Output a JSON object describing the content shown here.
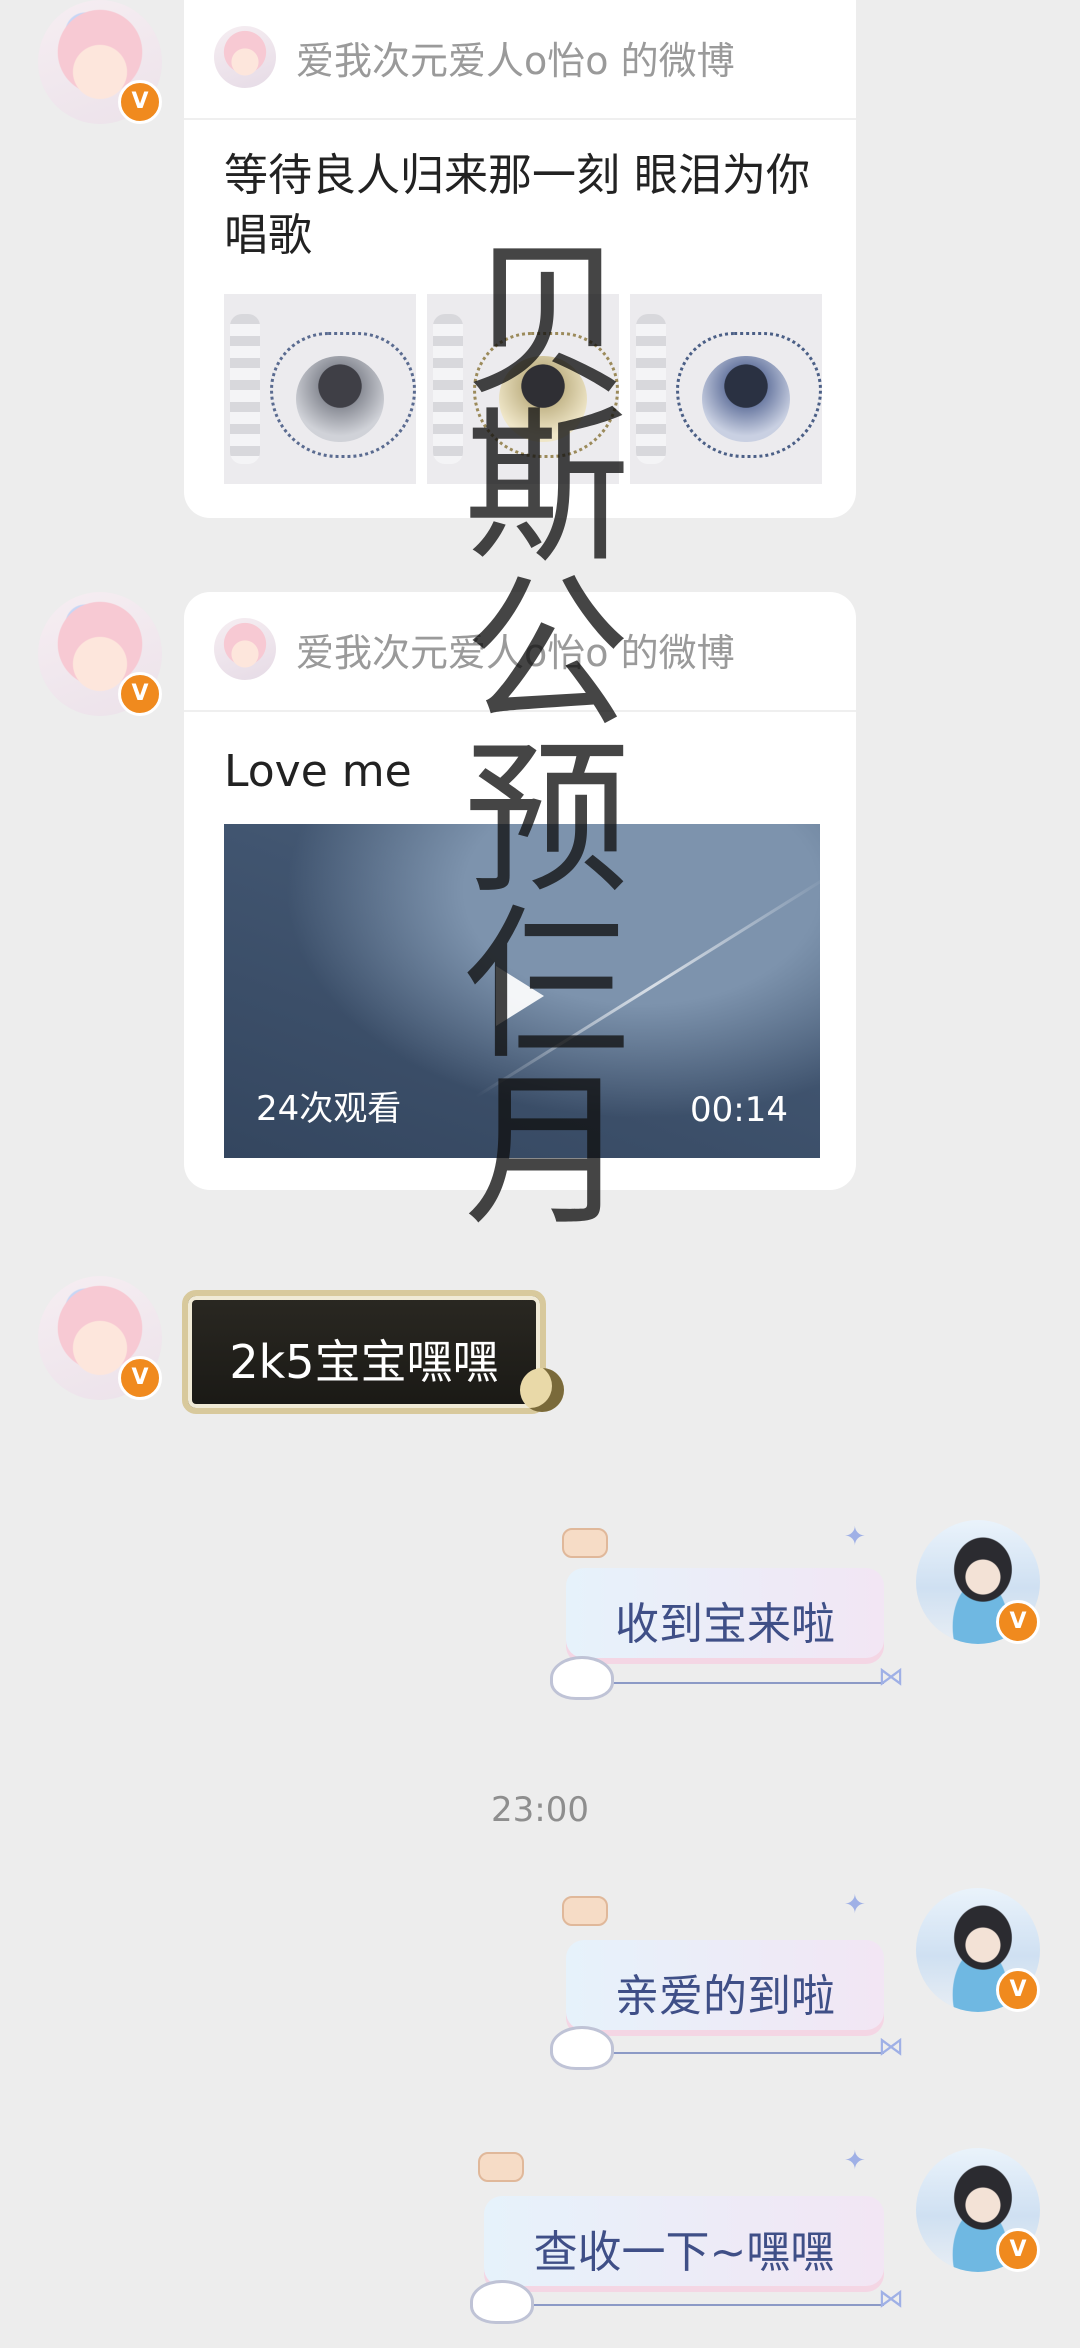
{
  "chat": {
    "card1": {
      "source": "爱我次元爱人o怡o 的微博",
      "text": "等待良人归来那一刻 眼泪为你唱歌"
    },
    "card2": {
      "source": "爱我次元爱人o怡o 的微博",
      "text": "Love me",
      "video": {
        "views": "24次观看",
        "duration": "00:14"
      }
    },
    "msg_left_1": "2k5宝宝嘿嘿",
    "msg_right_1": "收到宝来啦",
    "time_label": "23:00",
    "msg_right_2": "亲爱的到啦",
    "msg_right_3": "查收一下~嘿嘿"
  },
  "watermark": [
    "贝",
    "斯",
    "公",
    "预",
    "仨",
    "月"
  ],
  "colors": {
    "background": "#ededed",
    "card": "#ffffff",
    "verified_badge": "#f08a1e",
    "pastel_text": "#3f4f87"
  },
  "icons": {
    "verified": "v-badge-icon",
    "play": "play-icon"
  }
}
